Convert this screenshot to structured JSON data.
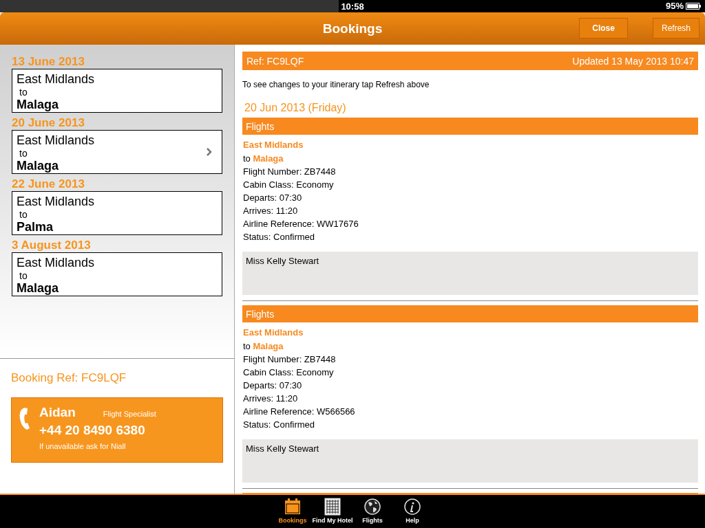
{
  "status_bar": {
    "time": "10:58",
    "battery": "95%"
  },
  "nav": {
    "title": "Bookings",
    "buttons": [
      "Close",
      "Refresh"
    ]
  },
  "bookings": [
    {
      "date": "13 June 2013",
      "from": "East Midlands",
      "to_label": "to",
      "destination": "Malaga",
      "selected": false
    },
    {
      "date": "20 June 2013",
      "from": "East Midlands",
      "to_label": "to",
      "destination": "Malaga",
      "selected": true
    },
    {
      "date": "22 June 2013",
      "from": "East Midlands",
      "to_label": "to",
      "destination": "Palma",
      "selected": false
    },
    {
      "date": "3 August 2013",
      "from": "East Midlands",
      "to_label": "to",
      "destination": "Malaga",
      "selected": false
    }
  ],
  "booking_ref": "Booking Ref: FC9LQF",
  "contact": {
    "name": "Aidan",
    "role": "Flight Specialist",
    "phone": "+44 20 8490 6380",
    "note": "If unavailable ask for Niall"
  },
  "detail": {
    "ref": "Ref: FC9LQF",
    "updated": "Updated 13 May 2013 10:47",
    "hint": "To see changes to your itinerary tap Refresh above",
    "day": "20 Jun 2013 (Friday)",
    "sections": [
      {
        "title": "Flights",
        "origin": "East Midlands",
        "to_label": "to",
        "destination": "Malaga",
        "lines": [
          "Flight Number: ZB7448",
          "Cabin Class: Economy",
          "Departs: 07:30",
          "Arrives: 11:20",
          "Airline Reference: WW17676",
          "Status: Confirmed"
        ],
        "passenger": "Miss Kelly Stewart"
      },
      {
        "title": "Flights",
        "origin": "East Midlands",
        "to_label": "to",
        "destination": "Malaga",
        "lines": [
          "Flight Number: ZB7448",
          "Cabin Class: Economy",
          "Departs: 07:30",
          "Arrives: 11:20",
          "Airline Reference: W566566",
          "Status: Confirmed"
        ],
        "passenger": "Miss Kelly Stewart"
      }
    ]
  },
  "tabs": [
    {
      "label": "Bookings",
      "kind": "calendar",
      "selected": true
    },
    {
      "label": "Find My Hotel",
      "kind": "building",
      "selected": false
    },
    {
      "label": "Flights",
      "kind": "globe",
      "selected": false
    },
    {
      "label": "Help",
      "kind": "info",
      "selected": false
    }
  ]
}
